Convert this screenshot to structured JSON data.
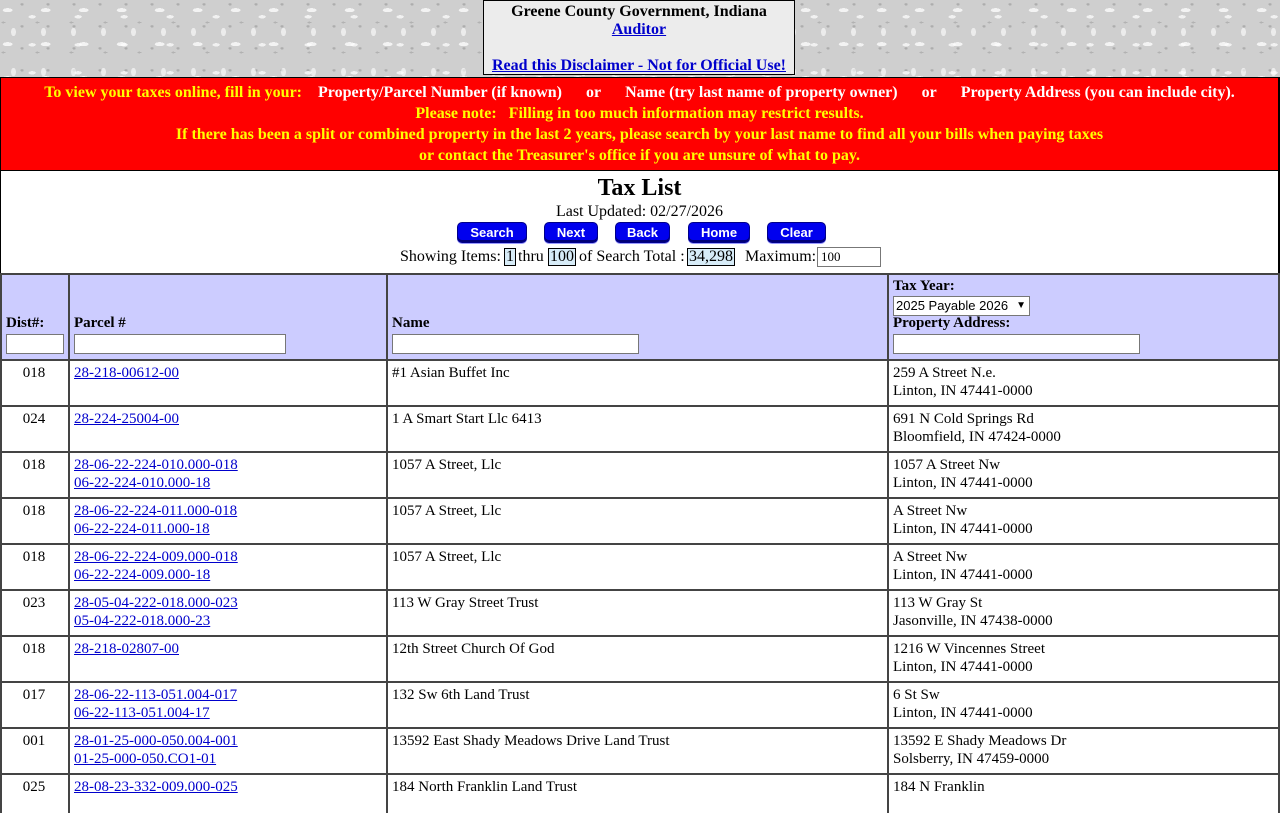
{
  "header": {
    "county": "Greene County Government, Indiana",
    "office_link": "Auditor",
    "disclaimer_link": "Read this Disclaimer - Not for Official Use!"
  },
  "notice": {
    "prefix": "To view your taxes online, fill in your:",
    "opt_parcel": "Property/Parcel Number (if known)",
    "or1": "or",
    "opt_name": "Name (try last name of property owner)",
    "or2": "or",
    "opt_address": "Property Address (you can include city).",
    "line2": "Please note:   Filling in too much information may restrict results.",
    "line3": "If there has been a split or combined property in the last 2 years, please search by your last name to find all your bills when paying taxes",
    "line4": "or contact the Treasurer's office if you are unsure of what to pay."
  },
  "panel": {
    "title": "Tax List",
    "last_updated": "Last Updated: 02/27/2026",
    "buttons": [
      "Search",
      "Next",
      "Back",
      "Home",
      "Clear"
    ],
    "showing_label": "Showing Items:",
    "from": "1",
    "thru_label": "thru",
    "to": "100",
    "total_label": "of Search Total :",
    "total": "34,298",
    "max_label": "Maximum:",
    "max_value": "100"
  },
  "table": {
    "headers": {
      "dist": "Dist#:",
      "parcel": "Parcel #",
      "name": "Name",
      "tax_year_label": "Tax Year:",
      "tax_year_value": "2025 Payable 2026",
      "address": "Property Address:"
    },
    "rows": [
      {
        "dist": "018",
        "parcel1": "28-218-00612-00",
        "parcel2": "",
        "name": "#1 Asian Buffet Inc",
        "addr1": "259 A Street N.e.",
        "addr2": "Linton, IN 47441-0000"
      },
      {
        "dist": "024",
        "parcel1": "28-224-25004-00",
        "parcel2": "",
        "name": "1 A Smart Start Llc 6413",
        "addr1": "691 N Cold Springs Rd",
        "addr2": "Bloomfield, IN 47424-0000"
      },
      {
        "dist": "018",
        "parcel1": "28-06-22-224-010.000-018",
        "parcel2": "06-22-224-010.000-18",
        "name": "1057 A Street, Llc",
        "addr1": "1057 A Street Nw",
        "addr2": "Linton, IN 47441-0000"
      },
      {
        "dist": "018",
        "parcel1": "28-06-22-224-011.000-018",
        "parcel2": "06-22-224-011.000-18",
        "name": "1057 A Street, Llc",
        "addr1": "A Street Nw",
        "addr2": "Linton, IN 47441-0000"
      },
      {
        "dist": "018",
        "parcel1": "28-06-22-224-009.000-018",
        "parcel2": "06-22-224-009.000-18",
        "name": "1057 A Street, Llc",
        "addr1": "A Street Nw",
        "addr2": "Linton, IN 47441-0000"
      },
      {
        "dist": "023",
        "parcel1": "28-05-04-222-018.000-023",
        "parcel2": "05-04-222-018.000-23",
        "name": "113 W Gray Street Trust",
        "addr1": "113 W Gray St",
        "addr2": "Jasonville, IN 47438-0000"
      },
      {
        "dist": "018",
        "parcel1": "28-218-02807-00",
        "parcel2": "",
        "name": "12th Street Church Of God",
        "addr1": "1216 W Vincennes Street",
        "addr2": "Linton, IN 47441-0000"
      },
      {
        "dist": "017",
        "parcel1": "28-06-22-113-051.004-017",
        "parcel2": "06-22-113-051.004-17",
        "name": "132 Sw 6th Land Trust",
        "addr1": "6 St Sw",
        "addr2": "Linton, IN 47441-0000"
      },
      {
        "dist": "001",
        "parcel1": "28-01-25-000-050.004-001",
        "parcel2": "01-25-000-050.CO1-01",
        "name": "13592 East Shady Meadows Drive Land Trust",
        "addr1": "13592 E Shady Meadows Dr",
        "addr2": "Solsberry, IN 47459-0000"
      },
      {
        "dist": "025",
        "parcel1": "28-08-23-332-009.000-025",
        "parcel2": "",
        "name": "184 North Franklin Land Trust",
        "addr1": "184 N Franklin",
        "addr2": ""
      }
    ]
  }
}
